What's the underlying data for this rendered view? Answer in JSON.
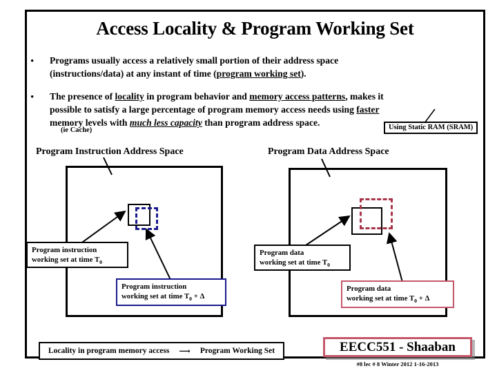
{
  "slide": {
    "title": "Access Locality & Program Working Set",
    "bullets": [
      {
        "marker": "•",
        "line1_a": "Programs usually access a relatively small portion of their address space",
        "line2_a": "(instructions/data) at any instant of time (",
        "line2_underline": "program working set",
        "line2_b": ")."
      },
      {
        "marker": "•",
        "line1_a": "The presence of ",
        "line1_u1": "locality",
        "line1_b": " in program behavior and ",
        "line1_u2": "memory access patterns",
        "line1_c": ", makes it",
        "line2_a": "possible to satisfy a large percentage of program memory access needs using ",
        "line2_u": "faster",
        "line3_a": "memory levels with ",
        "line3_ital": "much less capacity",
        "line3_b": " than program address space."
      }
    ],
    "ie_cache_note": "(ie Cache)",
    "sram_callout": "Using Static RAM (SRAM)"
  },
  "diagram": {
    "left": {
      "heading": "Program Instruction Address Space",
      "label_t0": {
        "line1": "Program instruction",
        "line2_pre": "working set at time T",
        "line2_sub": "0"
      },
      "label_t0_delta": {
        "line1": "Program instruction",
        "line2_pre": "working set at time T",
        "line2_sub": "0",
        "line2_post": " + Δ"
      },
      "dashed_color": "#1a1a8c"
    },
    "right": {
      "heading": "Program Data Address Space",
      "label_t0": {
        "line1": "Program data",
        "line2_pre": "working set at time T",
        "line2_sub": "0"
      },
      "label_t0_delta": {
        "line1": "Program data",
        "line2_pre": "working set at time T",
        "line2_sub": "0",
        "line2_post": " + Δ"
      },
      "dashed_color": "#a8344a"
    }
  },
  "legend": {
    "left_text": "Locality in program memory access",
    "arrow": "⟶",
    "right_text": "Program Working Set"
  },
  "footer": {
    "banner": "EECC551 - Shaaban",
    "note": "#8  lec # 8   Winter 2012  1-16-2013",
    "banner_border_color": "#c4576b"
  }
}
